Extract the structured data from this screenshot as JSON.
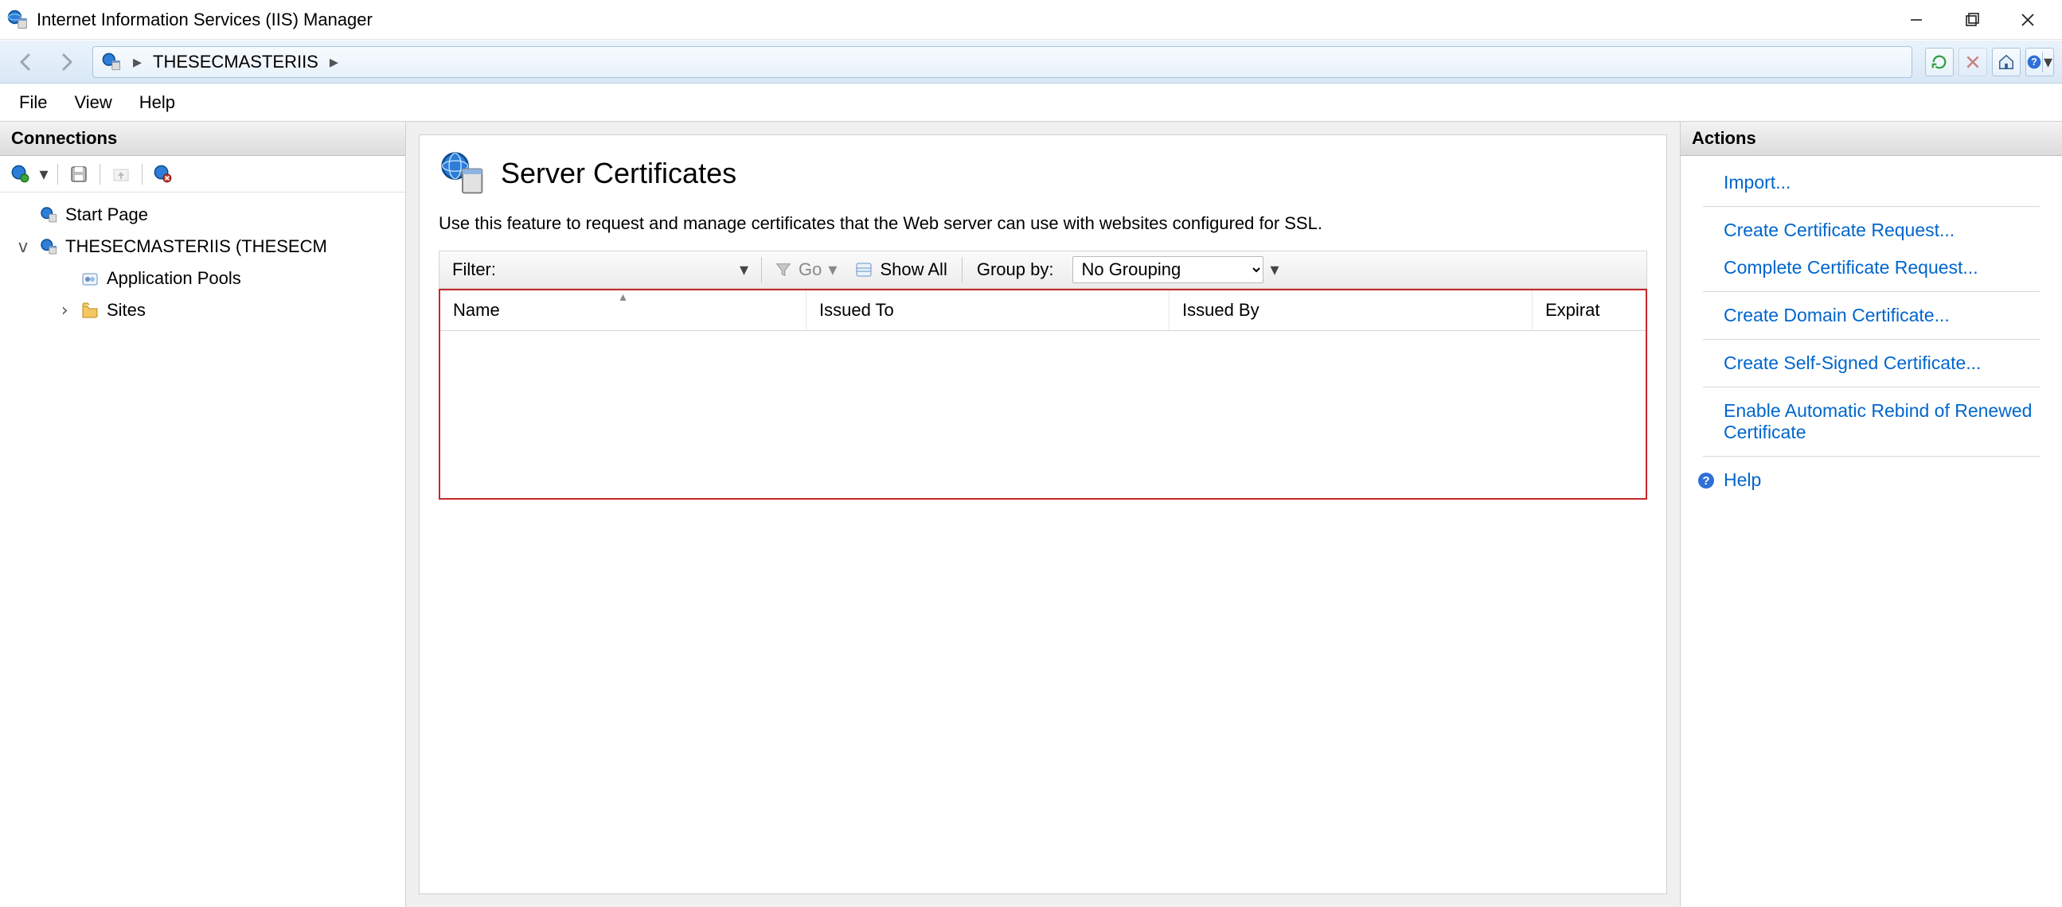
{
  "window": {
    "title": "Internet Information Services (IIS) Manager"
  },
  "breadcrumb": {
    "server": "THESECMASTERIIS"
  },
  "menu": {
    "file": "File",
    "view": "View",
    "help": "Help"
  },
  "connections": {
    "header": "Connections",
    "tree": {
      "start_page": "Start Page",
      "server_node": "THESECMASTERIIS (THESECM",
      "app_pools": "Application Pools",
      "sites": "Sites"
    }
  },
  "page": {
    "title": "Server Certificates",
    "description": "Use this feature to request and manage certificates that the Web server can use with websites configured for SSL."
  },
  "filterbar": {
    "filter_label": "Filter:",
    "go_label": "Go",
    "show_all_label": "Show All",
    "group_by_label": "Group by:",
    "group_by_value": "No Grouping"
  },
  "grid": {
    "columns": {
      "name": "Name",
      "issued_to": "Issued To",
      "issued_by": "Issued By",
      "expiration": "Expirat"
    }
  },
  "actions": {
    "header": "Actions",
    "import": "Import...",
    "create_request": "Create Certificate Request...",
    "complete_request": "Complete Certificate Request...",
    "create_domain": "Create Domain Certificate...",
    "create_self_signed": "Create Self-Signed Certificate...",
    "enable_auto_rebind": "Enable Automatic Rebind of Renewed Certificate",
    "help": "Help"
  }
}
